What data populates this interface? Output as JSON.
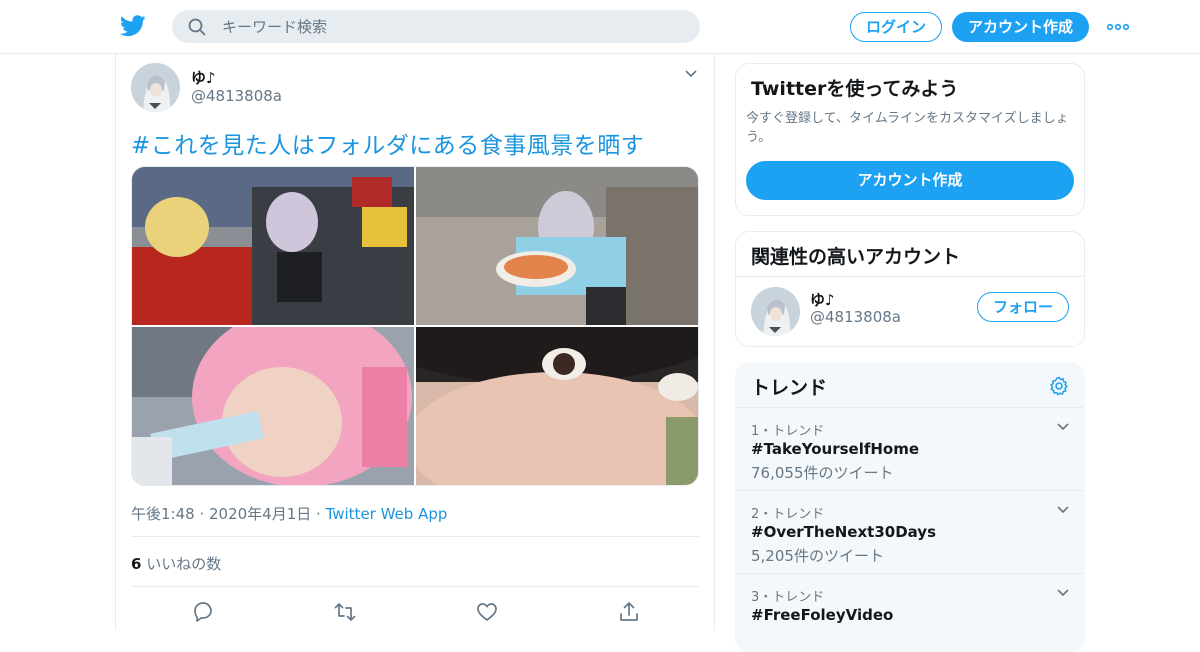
{
  "header": {
    "search_placeholder": "キーワード検索",
    "login_label": "ログイン",
    "signup_label": "アカウント作成"
  },
  "tweet": {
    "display_name": "ゆ♪",
    "screen_name": "@4813808a",
    "text": "#これを見た人はフォルダにある食事風景を晒す",
    "timestamp": "午後1:48 · 2020年4月1日",
    "separator": " · ",
    "via": "Twitter Web App",
    "like_count": "6",
    "like_label": " いいねの数"
  },
  "sidebar": {
    "promo": {
      "title": "Twitterを使ってみよう",
      "text": "今すぐ登録して、タイムラインをカスタマイズしましょう。",
      "button_label": "アカウント作成"
    },
    "related": {
      "title": "関連性の高いアカウント",
      "display_name": "ゆ♪",
      "screen_name": "@4813808a",
      "follow_label": "フォロー"
    },
    "trends": {
      "title": "トレンド",
      "items": [
        {
          "meta": "1・トレンド",
          "name": "#TakeYourselfHome",
          "count": "76,055件のツイート"
        },
        {
          "meta": "2・トレンド",
          "name": "#OverTheNext30Days",
          "count": "5,205件のツイート"
        },
        {
          "meta": "3・トレンド",
          "name": "#FreeFoleyVideo",
          "count": ""
        }
      ]
    }
  },
  "colors": {
    "brand": "#1da1f2",
    "link": "#1b95e0",
    "secondary_text": "#657786",
    "border": "#e6ecf0"
  },
  "icons": [
    "twitter-logo-icon",
    "search-icon",
    "more-dots-icon",
    "chevron-down-icon",
    "reply-icon",
    "retweet-icon",
    "like-heart-icon",
    "share-icon",
    "gear-icon"
  ]
}
